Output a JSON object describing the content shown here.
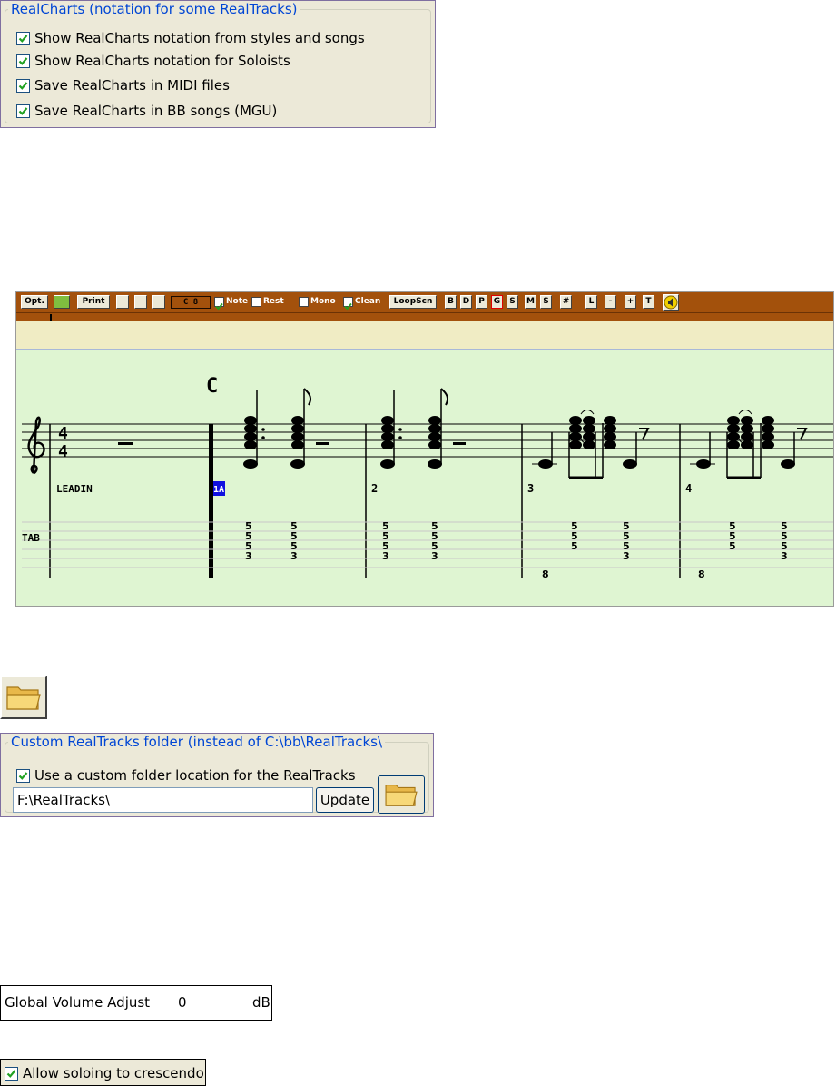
{
  "realcharts_group": {
    "title": "RealCharts (notation for some RealTracks)",
    "options": [
      {
        "label": "Show RealCharts notation from styles and songs",
        "checked": true
      },
      {
        "label": "Show RealCharts notation for Soloists",
        "checked": true
      },
      {
        "label": "Save RealCharts in MIDI files",
        "checked": true
      },
      {
        "label": "Save RealCharts in BB songs (MGU)",
        "checked": true
      }
    ]
  },
  "notation_window": {
    "toolbar": {
      "opt": "Opt.",
      "print": "Print",
      "key": "C 8",
      "note": "Note",
      "rest": "Rest",
      "mono": "Mono",
      "clean": "Clean",
      "loopscn": "LoopScn",
      "track_buttons": [
        "B",
        "D",
        "P",
        "G",
        "S",
        "M",
        "S",
        "#"
      ],
      "size_buttons": [
        "L",
        "-",
        "+",
        "T"
      ]
    },
    "chord_symbol": "C",
    "time_signature": {
      "top": "4",
      "bottom": "4"
    },
    "bar_labels": [
      "LEADIN",
      "1A",
      "2",
      "3",
      "4"
    ],
    "tab_label": "TAB",
    "tab_numbers": {
      "bar1": [
        [
          "5",
          "5",
          "5",
          "3"
        ],
        [
          "5",
          "5",
          "5",
          "3"
        ]
      ],
      "bar2": [
        [
          "5",
          "5",
          "5",
          "3"
        ],
        [
          "5",
          "5",
          "5",
          "3"
        ]
      ],
      "bar3": [
        [
          "5",
          "5",
          "5"
        ],
        [
          "5",
          "5",
          "5",
          "3"
        ]
      ],
      "bar4": [
        [
          "5",
          "5",
          "5"
        ],
        [
          "5",
          "5",
          "5",
          "3"
        ]
      ],
      "low8_bar3": "8",
      "low8_bar4": "8"
    }
  },
  "custom_folder_group": {
    "title": "Custom RealTracks folder (instead of C:\\bb\\RealTracks\\",
    "option": {
      "label": "Use a custom folder location for the RealTracks",
      "checked": true
    },
    "path_value": "F:\\RealTracks\\",
    "update_label": "Update"
  },
  "global_volume": {
    "label": "Global Volume Adjust",
    "value": "0",
    "unit": "dB"
  },
  "allow_soloing": {
    "label": "Allow soloing to crescendo",
    "checked": true
  },
  "colors": {
    "panel": "#ece9d8",
    "title_blue": "#0046d5",
    "notation_bg": "#dff5d2",
    "toolbar_brown": "#a3510c",
    "check_green": "#21a121"
  }
}
